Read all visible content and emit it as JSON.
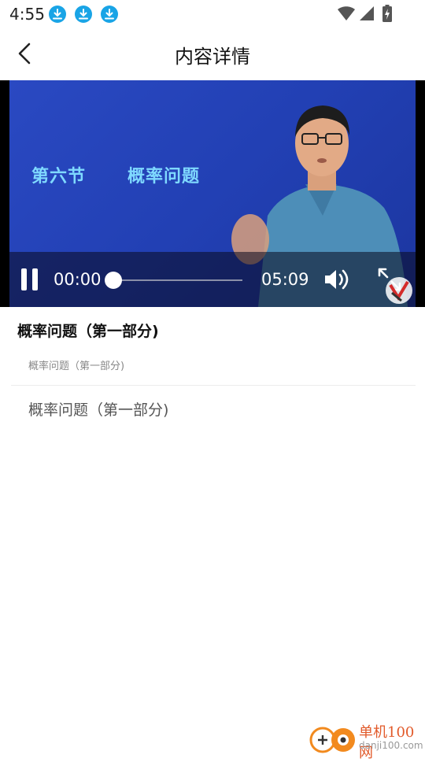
{
  "status_bar": {
    "time": "4:55",
    "notification_icons": [
      "download-icon",
      "download-icon",
      "download-icon"
    ],
    "right_icons": [
      "wifi-icon",
      "cell-signal-icon",
      "battery-charging-icon"
    ]
  },
  "header": {
    "title": "内容详情",
    "back_icon": "chevron-left-icon"
  },
  "video": {
    "slide_section": "第六节",
    "slide_topic": "概率问题",
    "current_time": "00:00",
    "duration": "05:09",
    "progress": 0,
    "state": "playing",
    "accent_color": "#7fd9ff"
  },
  "content": {
    "title": "概率问题（第一部分)",
    "subtitle": "概率问题（第一部分)",
    "body": "概率问题（第一部分)"
  },
  "watermark": {
    "name": "单机100网",
    "url": "danji100.com"
  },
  "colors": {
    "download_badge": "#19a4e6",
    "video_bg": "#2240b4",
    "watermark_orange": "#e25a2a"
  }
}
